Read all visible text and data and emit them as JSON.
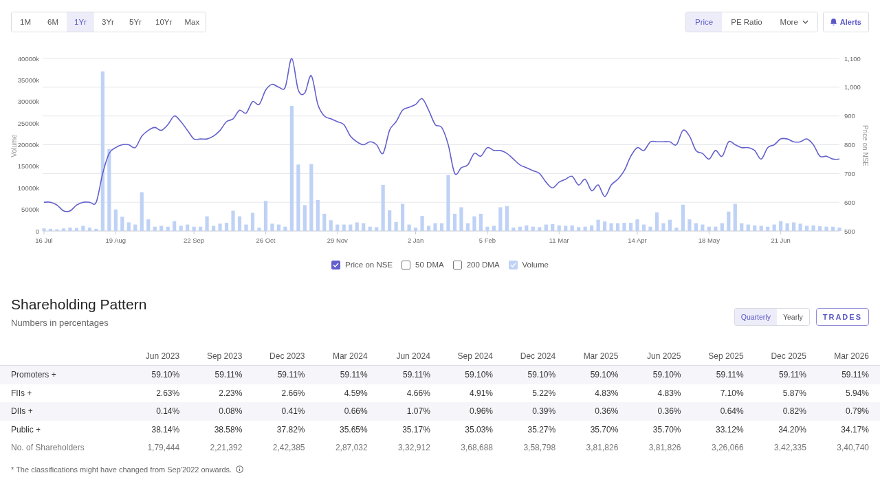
{
  "toolbar": {
    "ranges": [
      {
        "label": "1M",
        "selected": false
      },
      {
        "label": "6M",
        "selected": false
      },
      {
        "label": "1Yr",
        "selected": true
      },
      {
        "label": "3Yr",
        "selected": false
      },
      {
        "label": "5Yr",
        "selected": false
      },
      {
        "label": "10Yr",
        "selected": false
      },
      {
        "label": "Max",
        "selected": false
      }
    ],
    "views": [
      {
        "label": "Price",
        "kind": "tab",
        "selected": true
      },
      {
        "label": "PE Ratio",
        "kind": "tab",
        "selected": false
      },
      {
        "label": "More",
        "kind": "dropdown",
        "selected": false
      }
    ],
    "alerts_button": {
      "label": "Alerts"
    }
  },
  "chart": {
    "chart_data": {
      "type": "line",
      "grid": true,
      "ylabel": "Volume",
      "y2label": "Price on NSE",
      "ylim": [
        0,
        40000
      ],
      "y2lim": [
        500,
        1100
      ],
      "yticks": [
        0,
        {
          "value": 5000,
          "label": "5000k"
        },
        {
          "value": 10000,
          "label": "10000k"
        },
        {
          "value": 15000,
          "label": "15000k"
        },
        {
          "value": 20000,
          "label": "20000k"
        },
        {
          "value": 25000,
          "label": "25000k"
        },
        {
          "value": 30000,
          "label": "30000k"
        },
        {
          "value": 35000,
          "label": "35000k"
        },
        {
          "value": 40000,
          "label": "40000k"
        }
      ],
      "y2ticks": [
        500,
        600,
        700,
        800,
        900,
        {
          "value": 1000,
          "label": "1,000"
        },
        {
          "value": 1100,
          "label": "1,100"
        }
      ],
      "categories": [
        "16 Jul",
        null,
        null,
        null,
        null,
        null,
        null,
        null,
        null,
        null,
        null,
        "19 Aug",
        null,
        null,
        null,
        null,
        null,
        null,
        null,
        null,
        null,
        null,
        null,
        "22 Sep",
        null,
        null,
        null,
        null,
        null,
        null,
        null,
        null,
        null,
        null,
        "26 Oct",
        null,
        null,
        null,
        null,
        null,
        null,
        null,
        null,
        null,
        null,
        "29 Nov",
        null,
        null,
        null,
        null,
        null,
        null,
        null,
        null,
        null,
        null,
        null,
        "2 Jan",
        null,
        null,
        null,
        null,
        null,
        null,
        null,
        null,
        null,
        null,
        "5 Feb",
        null,
        null,
        null,
        null,
        null,
        null,
        null,
        null,
        null,
        null,
        "11 Mar",
        null,
        null,
        null,
        null,
        null,
        null,
        null,
        null,
        null,
        null,
        null,
        "14 Apr",
        null,
        null,
        null,
        null,
        null,
        null,
        null,
        null,
        null,
        null,
        "18 May",
        null,
        null,
        null,
        null,
        null,
        null,
        null,
        null,
        null,
        null,
        "21 Jun",
        null,
        null,
        null,
        null,
        null,
        null,
        null,
        null,
        null
      ],
      "series": [
        {
          "axis": "y2",
          "color": "#6360cc",
          "values": [
            600,
            600,
            590,
            570,
            570,
            590,
            600,
            600,
            600,
            700,
            770,
            790,
            800,
            800,
            790,
            830,
            850,
            860,
            850,
            870,
            900,
            880,
            850,
            820,
            820,
            820,
            830,
            850,
            880,
            890,
            920,
            910,
            950,
            940,
            990,
            1010,
            1000,
            1000,
            1100,
            990,
            980,
            1040,
            940,
            900,
            890,
            880,
            870,
            830,
            810,
            800,
            810,
            800,
            770,
            850,
            880,
            920,
            930,
            940,
            960,
            920,
            870,
            860,
            800,
            700,
            720,
            730,
            770,
            760,
            790,
            780,
            780,
            770,
            750,
            730,
            720,
            710,
            700,
            670,
            650,
            670,
            680,
            690,
            660,
            680,
            640,
            660,
            620,
            660,
            680,
            710,
            760,
            790,
            780,
            810,
            810,
            810,
            810,
            800,
            850,
            830,
            780,
            770,
            750,
            780,
            760,
            810,
            800,
            790,
            790,
            780,
            750,
            790,
            800,
            820,
            820,
            810,
            810,
            820,
            800,
            760,
            760,
            750,
            750
          ]
        },
        {
          "type": "bar",
          "color": "#bfd2f6",
          "values": [
            600,
            500,
            400,
            600,
            800,
            700,
            1200,
            800,
            500,
            37000,
            19000,
            5000,
            3300,
            2000,
            1500,
            9000,
            2700,
            1000,
            1200,
            1000,
            2300,
            1200,
            1500,
            1000,
            1000,
            3400,
            1200,
            1700,
            1900,
            4700,
            3400,
            1500,
            4200,
            800,
            7000,
            1700,
            1500,
            1000,
            29000,
            15400,
            6000,
            15500,
            7200,
            4000,
            2500,
            1500,
            1500,
            1500,
            2000,
            1800,
            1000,
            900,
            10700,
            4800,
            2100,
            6300,
            1500,
            800,
            3500,
            1200,
            1800,
            1800,
            13000,
            4000,
            5500,
            1800,
            3400,
            4000,
            1000,
            1200,
            5500,
            5800,
            800,
            1000,
            1300,
            1000,
            900,
            1500,
            1600,
            1300,
            1200,
            1300,
            900,
            1000,
            1300,
            2600,
            2200,
            1800,
            1800,
            1900,
            1900,
            2700,
            1500,
            1000,
            4300,
            1800,
            2600,
            800,
            6100,
            2700,
            1800,
            1500,
            1000,
            1000,
            1800,
            4500,
            6300,
            1800,
            1500,
            1300,
            1200,
            1000,
            1500,
            2300,
            1800,
            2000,
            1700,
            1200,
            1300,
            1100,
            1000,
            1000,
            800
          ]
        }
      ]
    },
    "legend": [
      {
        "label": "Price on NSE",
        "checked": true,
        "color": "#6360cc"
      },
      {
        "label": "50 DMA",
        "checked": false
      },
      {
        "label": "200 DMA",
        "checked": false
      },
      {
        "label": "Volume",
        "checked": true,
        "color": "#bfd2f6"
      }
    ]
  },
  "shareholding": {
    "title": "Shareholding Pattern",
    "subtitle": "Numbers in percentages",
    "periods": [
      {
        "label": "Quarterly",
        "selected": true
      },
      {
        "label": "Yearly",
        "selected": false
      }
    ],
    "trades_button": {
      "label": "TRADES"
    },
    "table": {
      "columns": [
        "Jun 2023",
        "Sep 2023",
        "Dec 2023",
        "Mar 2024",
        "Jun 2024",
        "Sep 2024",
        "Dec 2024",
        "Mar 2025",
        "Jun 2025",
        "Sep 2025",
        "Dec 2025",
        "Mar 2026"
      ],
      "rows": [
        {
          "label": "Promoters +",
          "kind": "expandable",
          "values": [
            "59.10%",
            "59.11%",
            "59.11%",
            "59.11%",
            "59.11%",
            "59.10%",
            "59.10%",
            "59.10%",
            "59.10%",
            "59.11%",
            "59.11%",
            "59.11%"
          ]
        },
        {
          "label": "FIIs +",
          "kind": "expandable",
          "values": [
            "2.63%",
            "2.23%",
            "2.66%",
            "4.59%",
            "4.66%",
            "4.91%",
            "5.22%",
            "4.83%",
            "4.83%",
            "7.10%",
            "5.87%",
            "5.94%"
          ]
        },
        {
          "label": "DIIs +",
          "kind": "expandable",
          "values": [
            "0.14%",
            "0.08%",
            "0.41%",
            "0.66%",
            "1.07%",
            "0.96%",
            "0.39%",
            "0.36%",
            "0.36%",
            "0.64%",
            "0.82%",
            "0.79%"
          ]
        },
        {
          "label": "Public +",
          "kind": "expandable",
          "values": [
            "38.14%",
            "38.58%",
            "37.82%",
            "35.65%",
            "35.17%",
            "35.03%",
            "35.27%",
            "35.70%",
            "35.70%",
            "33.12%",
            "34.20%",
            "34.17%"
          ]
        },
        {
          "label": "No. of Shareholders",
          "kind": "count",
          "values": [
            "1,79,444",
            "2,21,392",
            "2,42,385",
            "2,87,032",
            "3,32,912",
            "3,68,688",
            "3,58,798",
            "3,81,826",
            "3,81,826",
            "3,26,066",
            "3,42,335",
            "3,40,740"
          ]
        }
      ]
    },
    "footnote": "* The classifications might have changed from Sep'2022 onwards."
  }
}
